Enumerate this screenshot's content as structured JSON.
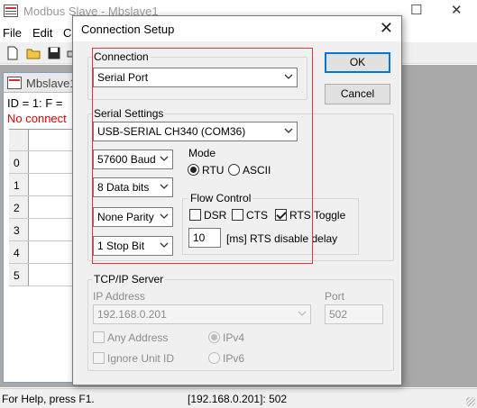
{
  "main_window": {
    "title": "Modbus Slave - Mbslave1",
    "menu": [
      "File",
      "Edit",
      "C"
    ],
    "child": {
      "title": "Mbslave1",
      "info_line": "ID = 1: F =",
      "status_line": "No connect",
      "rows": [
        "0",
        "1",
        "2",
        "3",
        "4",
        "5"
      ]
    },
    "statusbar": {
      "help": "For Help, press F1.",
      "address": "[192.168.0.201]: 502"
    },
    "colors": {
      "error_text": "#e00000",
      "highlight_box": "#e0383e"
    }
  },
  "dialog": {
    "title": "Connection Setup",
    "close_glyph": "✕",
    "connection": {
      "legend": "Connection",
      "value": "Serial Port"
    },
    "buttons": {
      "ok": "OK",
      "cancel": "Cancel"
    },
    "serial": {
      "legend": "Serial Settings",
      "port": "USB-SERIAL CH340 (COM36)",
      "baud": "57600 Baud",
      "data_bits": "8 Data bits",
      "parity": "None Parity",
      "stop_bits": "1 Stop Bit",
      "mode": {
        "label": "Mode",
        "rtu": "RTU",
        "ascii": "ASCII",
        "selected": "RTU"
      },
      "flow": {
        "label": "Flow Control",
        "dsr": "DSR",
        "cts": "CTS",
        "rts_toggle": "RTS Toggle",
        "rts_toggle_checked": true,
        "delay_value": "10",
        "delay_label": "[ms] RTS disable delay"
      }
    },
    "tcp": {
      "legend": "TCP/IP Server",
      "ip_label": "IP Address",
      "ip_value": "192.168.0.201",
      "port_label": "Port",
      "port_value": "502",
      "any_address": "Any Address",
      "ignore_unit_id": "Ignore Unit ID",
      "ipv4": "IPv4",
      "ipv6": "IPv6",
      "ip_version_selected": "IPv4"
    }
  }
}
